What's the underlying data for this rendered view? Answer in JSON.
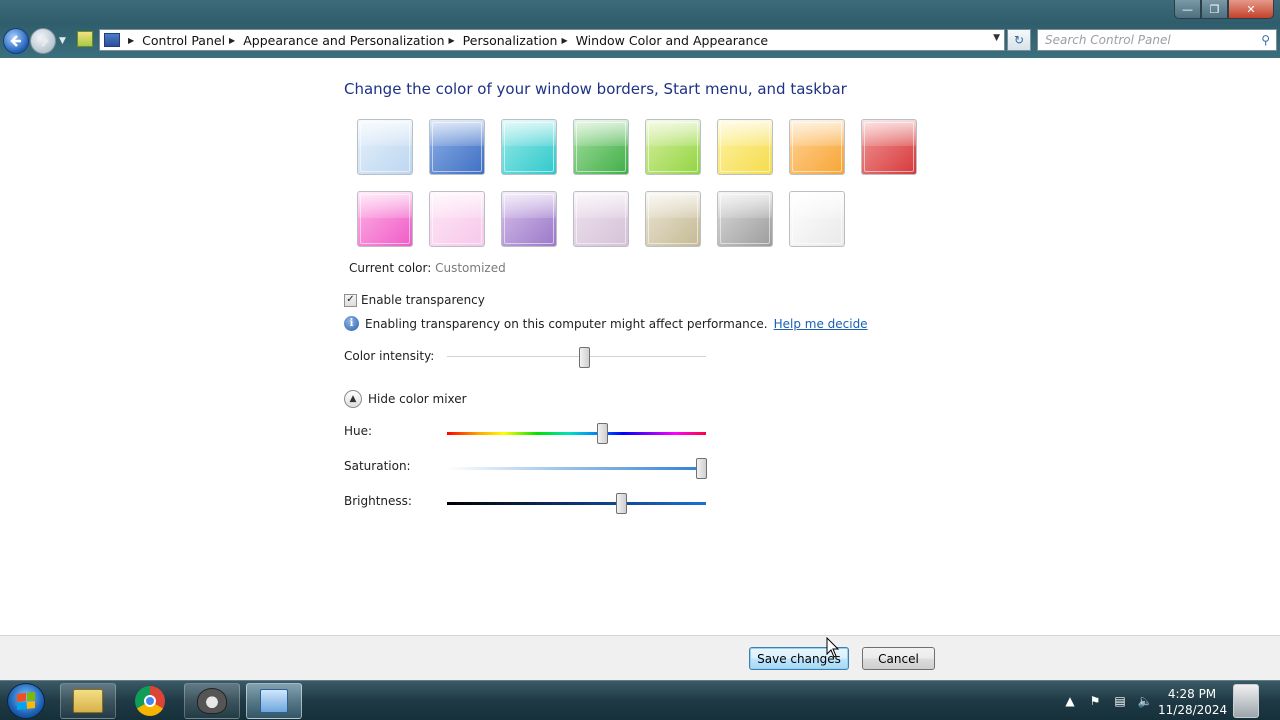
{
  "window": {
    "caption_buttons": [
      "minimize",
      "maximize",
      "close"
    ]
  },
  "address_bar": {
    "breadcrumbs": [
      "Control Panel",
      "Appearance and Personalization",
      "Personalization",
      "Window Color and Appearance"
    ]
  },
  "search": {
    "placeholder": "Search Control Panel"
  },
  "main": {
    "heading": "Change the color of your window borders, Start menu, and taskbar",
    "swatch_colors": [
      [
        "#e6f1fb",
        "#bcd6f0"
      ],
      [
        "#8fb1e6",
        "#3f6fc4"
      ],
      [
        "#9be9e9",
        "#2fc9cc"
      ],
      [
        "#a9e0a3",
        "#3fae46"
      ],
      [
        "#d8f0a0",
        "#93d443"
      ],
      [
        "#fff3a6",
        "#f4dc4c"
      ],
      [
        "#ffd49a",
        "#f7a534"
      ],
      [
        "#f29a9a",
        "#d6383a"
      ],
      [
        "#ffb4e6",
        "#ef5cc6"
      ],
      [
        "#ffe6f7",
        "#f7c8ea"
      ],
      [
        "#d8c2ec",
        "#9a78c8"
      ],
      [
        "#efe3ef",
        "#d5c1d8"
      ],
      [
        "#ece6d6",
        "#c5b994"
      ],
      [
        "#dcdcdc",
        "#9c9c9c"
      ],
      [
        "#ffffff",
        "#e9e9e9"
      ]
    ],
    "current_color_label": "Current color:",
    "current_color_value": "Customized",
    "transparency_label": "Enable transparency",
    "transparency_checked": true,
    "info_text": "Enabling transparency on this computer might affect performance.",
    "help_link": "Help me decide",
    "intensity_label": "Color intensity:",
    "intensity_value": 0.53,
    "mixer_toggle_label": "Hide color mixer",
    "hue_label": "Hue:",
    "hue_value": 0.6,
    "saturation_label": "Saturation:",
    "saturation_value": 0.98,
    "brightness_label": "Brightness:",
    "brightness_value": 0.67
  },
  "footer": {
    "save_label": "Save changes",
    "cancel_label": "Cancel"
  },
  "taskbar": {
    "apps": [
      "windows-explorer",
      "google-chrome",
      "raccoon-app",
      "control-panel"
    ],
    "active_app": "control-panel",
    "clock_time": "4:28 PM",
    "clock_date": "11/28/2024"
  }
}
